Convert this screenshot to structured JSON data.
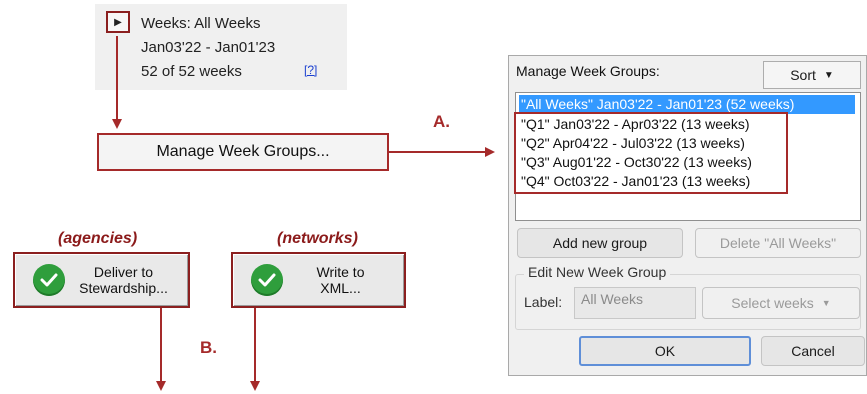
{
  "week_summary": {
    "title": "Weeks: All Weeks",
    "range": "Jan03'22 - Jan01'23",
    "count": "52 of 52 weeks",
    "help_link": "[?]"
  },
  "manage_bar": {
    "label": "Manage Week Groups..."
  },
  "annotations": {
    "a": "A.",
    "b": "B."
  },
  "actions": [
    {
      "role": "(agencies)",
      "line1": "Deliver to",
      "line2": "Stewardship..."
    },
    {
      "role": "(networks)",
      "line1": "Write to",
      "line2": "XML..."
    }
  ],
  "dialog": {
    "title": "Manage Week Groups:",
    "sort_label": "Sort",
    "week_groups": [
      "\"All Weeks\" Jan03'22 - Jan01'23 (52 weeks)",
      "\"Q1\" Jan03'22 - Apr03'22 (13 weeks)",
      "\"Q2\" Apr04'22 - Jul03'22 (13 weeks)",
      "\"Q3\" Aug01'22 - Oct30'22 (13 weeks)",
      "\"Q4\" Oct03'22 - Jan01'23 (13 weeks)"
    ],
    "selected_index": 0,
    "add_group_label": "Add new group",
    "delete_label": "Delete \"All Weeks\"",
    "edit_section_label": "Edit New Week Group",
    "label_caption": "Label:",
    "label_value": "All Weeks",
    "select_weeks_label": "Select weeks",
    "ok_label": "OK",
    "cancel_label": "Cancel"
  },
  "colors": {
    "accent_red": "#a52a2a",
    "selection_blue": "#3399ff",
    "check_green": "#2f9e3c"
  }
}
